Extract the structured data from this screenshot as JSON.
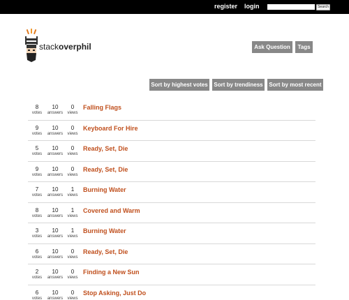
{
  "topbar": {
    "register_label": "register",
    "login_label": "login",
    "search_value": "",
    "search_button": "Search"
  },
  "logo": {
    "text_plain": "stack",
    "text_bold": "overphil"
  },
  "header": {
    "ask_label": "Ask Question",
    "tags_label": "Tags"
  },
  "sort": {
    "highest_votes": "Sort by highest votes",
    "trendiness": "Sort by trendiness",
    "most_recent": "Sort by most recent"
  },
  "labels": {
    "votes": "votes",
    "answers": "answers",
    "views": "views"
  },
  "questions": [
    {
      "votes": "8",
      "answers": "10",
      "views": "0",
      "title": "Falling Flags"
    },
    {
      "votes": "9",
      "answers": "10",
      "views": "0",
      "title": "Keyboard For Hire"
    },
    {
      "votes": "5",
      "answers": "10",
      "views": "0",
      "title": "Ready, Set, Die"
    },
    {
      "votes": "9",
      "answers": "10",
      "views": "0",
      "title": "Ready, Set, Die"
    },
    {
      "votes": "7",
      "answers": "10",
      "views": "1",
      "title": "Burning Water"
    },
    {
      "votes": "8",
      "answers": "10",
      "views": "1",
      "title": "Covered and Warm"
    },
    {
      "votes": "3",
      "answers": "10",
      "views": "1",
      "title": "Burning Water"
    },
    {
      "votes": "6",
      "answers": "10",
      "views": "0",
      "title": "Ready, Set, Die"
    },
    {
      "votes": "2",
      "answers": "10",
      "views": "0",
      "title": "Finding a New Sun"
    },
    {
      "votes": "6",
      "answers": "10",
      "views": "0",
      "title": "Stop Asking, Just Do"
    }
  ],
  "colors": {
    "accent": "#c0501e",
    "button": "#888888",
    "topbar": "#000000"
  }
}
